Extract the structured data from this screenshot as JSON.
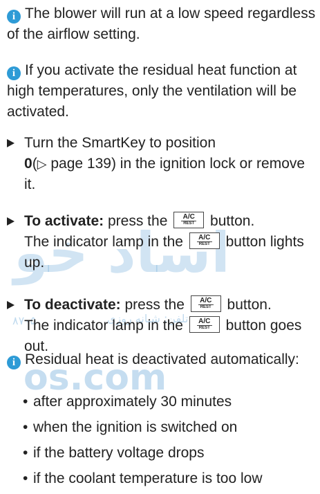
{
  "watermark": {
    "big": "اساد خو",
    "small": "تلفن: شبانه روزی",
    "digits": "۸۷۰۵",
    "site": "os.com"
  },
  "notes": {
    "blower": "The blower will run at a low speed regardless of the airflow setting.",
    "residual_high": "If you activate the residual heat function at high temperatures, only the ventilation will be activated.",
    "deactivated_auto": "Residual heat is deactivated automatically:"
  },
  "steps": {
    "smartkey": {
      "line1": "Turn the SmartKey to position",
      "pos": "0",
      "ref_open": "(",
      "ref_arrow": "▷",
      "ref_text": " page 139) in the ignition lock or remove it."
    },
    "activate": {
      "lead": "To activate:",
      "text1": " press the ",
      "text2": " button.",
      "text3": "The indicator lamp in the ",
      "text4": " button lights up."
    },
    "deactivate": {
      "lead": "To deactivate:",
      "text1": " press the ",
      "text2": " button.",
      "text3": "The indicator lamp in the ",
      "text4": " button goes out."
    }
  },
  "button_key": {
    "top": "A/C",
    "bottom": "REST"
  },
  "info_glyph": "i",
  "conditions": [
    "after approximately 30 minutes",
    "when the ignition is switched on",
    "if the battery voltage drops",
    "if the coolant temperature is too low"
  ],
  "bullet_char": "•"
}
